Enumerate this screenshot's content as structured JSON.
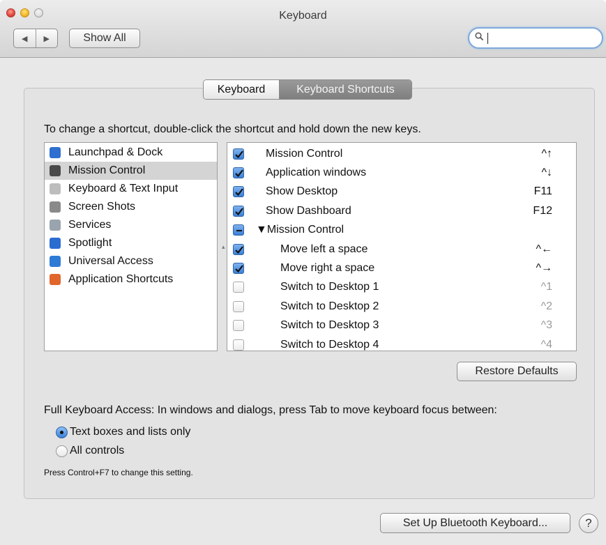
{
  "window": {
    "title": "Keyboard"
  },
  "toolbar": {
    "back_icon": "back-arrow-icon",
    "forward_icon": "forward-arrow-icon",
    "show_all_label": "Show All",
    "search_value": "",
    "search_icon": "search-icon"
  },
  "tabs": [
    {
      "label": "Keyboard",
      "selected": false
    },
    {
      "label": "Keyboard Shortcuts",
      "selected": true
    }
  ],
  "instructions": "To change a shortcut, double-click the shortcut and hold down the new keys.",
  "categories": [
    {
      "label": "Launchpad & Dock",
      "icon": "launchpad-dock-icon",
      "color": "#2f6fcf",
      "selected": false
    },
    {
      "label": "Mission Control",
      "icon": "mission-control-icon",
      "color": "#4a4a4a",
      "selected": true
    },
    {
      "label": "Keyboard & Text Input",
      "icon": "keyboard-text-icon",
      "color": "#bdbdbd",
      "selected": false
    },
    {
      "label": "Screen Shots",
      "icon": "screen-shots-icon",
      "color": "#8a8a8a",
      "selected": false
    },
    {
      "label": "Services",
      "icon": "services-gear-icon",
      "color": "#9aa4ae",
      "selected": false
    },
    {
      "label": "Spotlight",
      "icon": "spotlight-icon",
      "color": "#2b6cd1",
      "selected": false
    },
    {
      "label": "Universal Access",
      "icon": "universal-access-icon",
      "color": "#2e7bd6",
      "selected": false
    },
    {
      "label": "Application Shortcuts",
      "icon": "application-shortcuts-icon",
      "color": "#e0662b",
      "selected": false
    }
  ],
  "shortcuts": [
    {
      "name": "Mission Control",
      "key": "^↑",
      "state": "on",
      "indent": 0
    },
    {
      "name": "Application windows",
      "key": "^↓",
      "state": "on",
      "indent": 0
    },
    {
      "name": "Show Desktop",
      "key": "F11",
      "state": "on",
      "indent": 0
    },
    {
      "name": "Show Dashboard",
      "key": "F12",
      "state": "on",
      "indent": 0
    },
    {
      "name": "▼Mission Control",
      "key": "",
      "state": "mixed",
      "indent": -1
    },
    {
      "name": "Move left a space",
      "key": "^←",
      "state": "on",
      "indent": 1
    },
    {
      "name": "Move right a space",
      "key": "^→",
      "state": "on",
      "indent": 1
    },
    {
      "name": "Switch to Desktop 1",
      "key": "^1",
      "state": "off",
      "indent": 1
    },
    {
      "name": "Switch to Desktop 2",
      "key": "^2",
      "state": "off",
      "indent": 1
    },
    {
      "name": "Switch to Desktop 3",
      "key": "^3",
      "state": "off",
      "indent": 1
    },
    {
      "name": "Switch to Desktop 4",
      "key": "^4",
      "state": "off",
      "indent": 1
    }
  ],
  "restore_defaults_label": "Restore Defaults",
  "full_keyboard_access": {
    "label": "Full Keyboard Access: In windows and dialogs, press Tab to move keyboard focus between:",
    "options": [
      {
        "label": "Text boxes and lists only",
        "selected": true
      },
      {
        "label": "All controls",
        "selected": false
      }
    ],
    "hint": "Press Control+F7 to change this setting."
  },
  "footer": {
    "bluetooth_label": "Set Up Bluetooth Keyboard...",
    "help_label": "?"
  }
}
